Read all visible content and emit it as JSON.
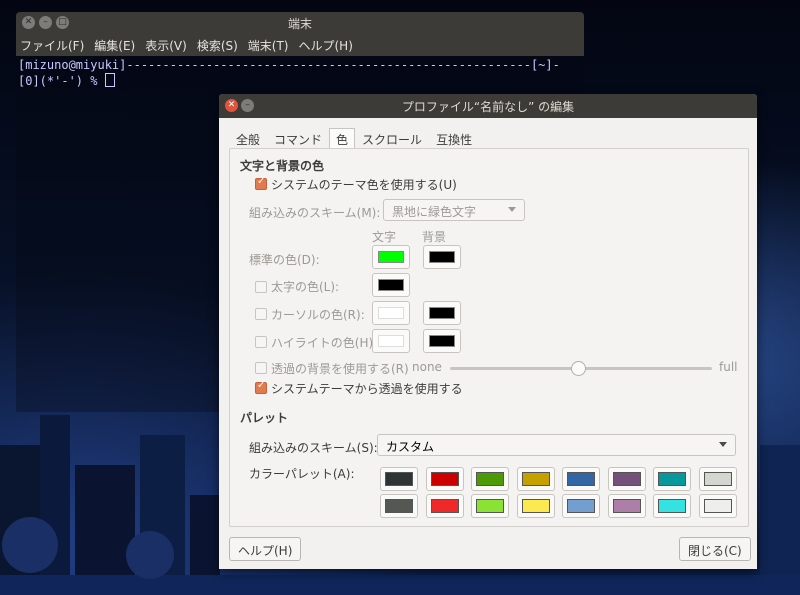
{
  "terminal": {
    "title": "端末",
    "menu": [
      "ファイル(F)",
      "編集(E)",
      "表示(V)",
      "検索(S)",
      "端末(T)",
      "ヘルプ(H)"
    ],
    "lines": [
      "[mizuno@miyuki]--------------------------------------------------------[~]-",
      "[0](*'-') % "
    ]
  },
  "dialog": {
    "title": "プロファイル“名前なし” の編集",
    "tabs": [
      "全般",
      "コマンド",
      "色",
      "スクロール",
      "互換性"
    ],
    "active_tab": "色",
    "text_bg_section": {
      "heading": "文字と背景の色",
      "use_theme_colors": {
        "label": "システムのテーマ色を使用する(U)",
        "checked": true
      },
      "builtin_scheme_label": "組み込みのスキーム(M):",
      "builtin_scheme_value": "黒地に緑色文字",
      "col_text": "文字",
      "col_bg": "背景",
      "default_color": {
        "label": "標準の色(D):",
        "text": "#00ff00",
        "bg": "#000000"
      },
      "bold_color": {
        "label": "太字の色(L):",
        "checked": false,
        "text": "#000000"
      },
      "cursor_color": {
        "label": "カーソルの色(R):",
        "checked": false,
        "text": "#ffffff",
        "bg": "#000000"
      },
      "highlight_color": {
        "label": "ハイライトの色(H):",
        "checked": false,
        "text": "#ffffff",
        "bg": "#000000"
      },
      "transparent_bg": {
        "label": "透過の背景を使用する(R)",
        "checked": false,
        "min_label": "none",
        "max_label": "full",
        "value": 0.5
      },
      "theme_transparency": {
        "label": "システムテーマから透過を使用する",
        "checked": true
      }
    },
    "palette_section": {
      "heading": "パレット",
      "builtin_scheme_label": "組み込みのスキーム(S):",
      "builtin_scheme_value": "カスタム",
      "palette_label": "カラーパレット(A):",
      "row1": [
        "#2e3436",
        "#cc0000",
        "#4e9a06",
        "#c4a000",
        "#3465a4",
        "#75507b",
        "#06989a",
        "#d3d7cf"
      ],
      "row2": [
        "#555753",
        "#ef2929",
        "#8ae234",
        "#fce94f",
        "#729fcf",
        "#ad7fa8",
        "#34e2e2",
        "#eeeeec"
      ]
    },
    "help_button": "ヘルプ(H)",
    "close_button": "閉じる(C)"
  }
}
